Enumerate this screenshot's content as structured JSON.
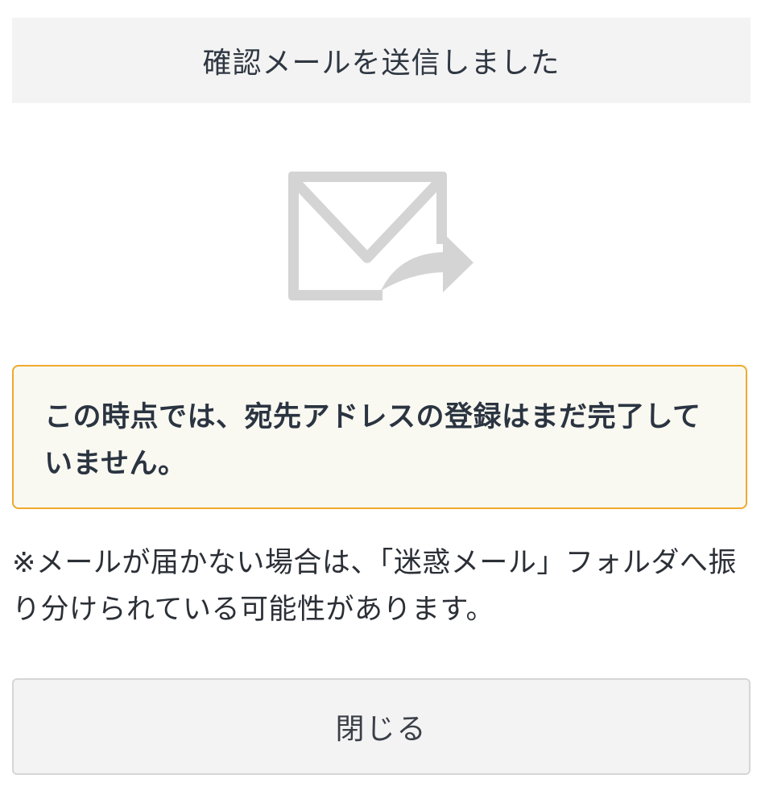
{
  "header": {
    "title": "確認メールを送信しました"
  },
  "icon": {
    "name": "mail-send-icon",
    "color": "#d4d4d4"
  },
  "notice": {
    "text": "この時点では、宛先アドレスの登録はまだ完了していません。",
    "border_color": "#f0a92e",
    "background_color": "#f9f9f1"
  },
  "note": {
    "text": "※メールが届かない場合は、「迷惑メール」フォルダへ振り分けられている可能性があります。"
  },
  "close_button": {
    "label": "閉じる"
  }
}
